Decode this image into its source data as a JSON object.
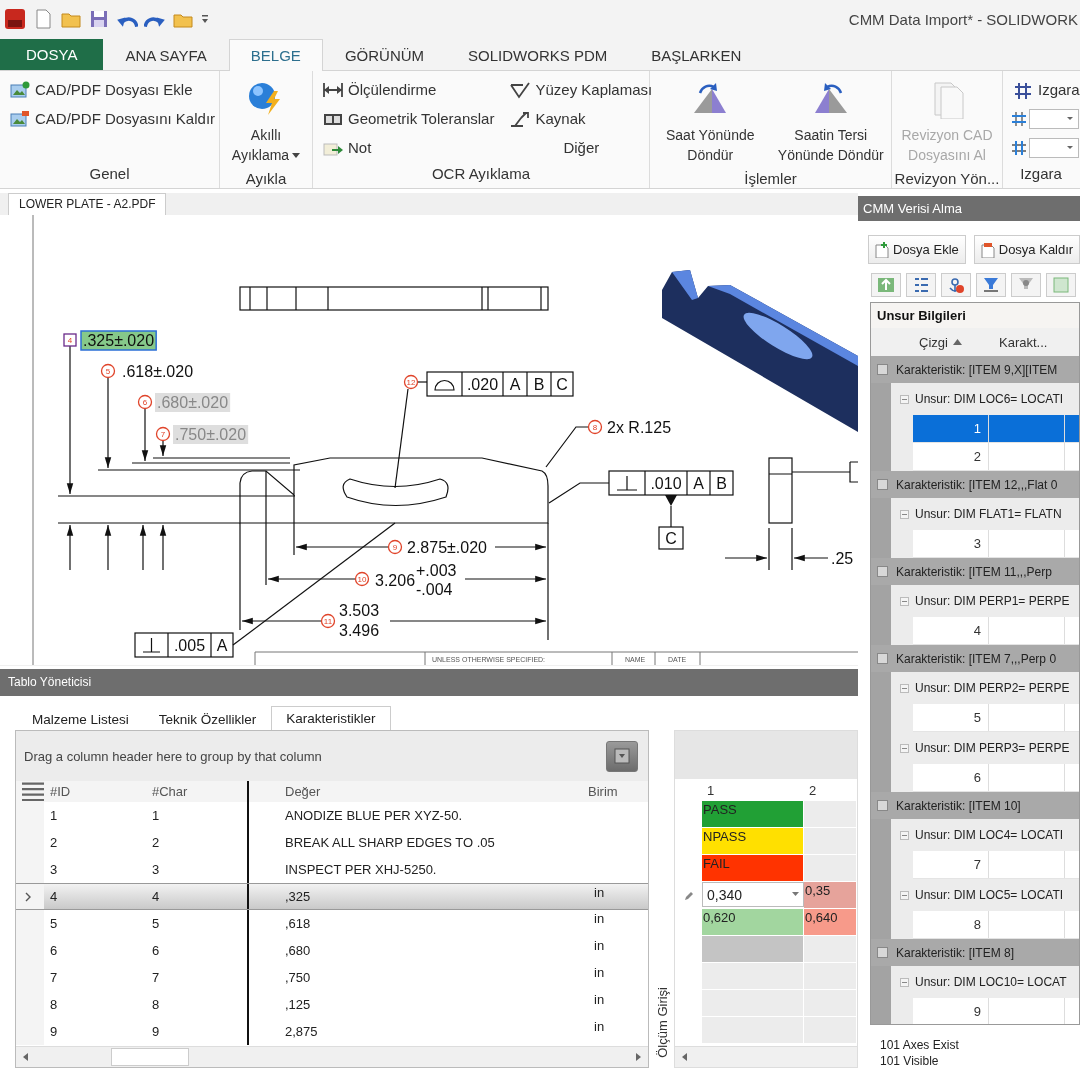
{
  "window": {
    "title": "CMM Data Import* - SOLIDWORK"
  },
  "ribbon": {
    "tabs": [
      {
        "label": "DOSYA",
        "kind": "file",
        "selected": false
      },
      {
        "label": "ANA SAYFA",
        "kind": "tab",
        "selected": false
      },
      {
        "label": "BELGE",
        "kind": "tab",
        "selected": true
      },
      {
        "label": "GÖRÜNÜM",
        "kind": "tab",
        "selected": false
      },
      {
        "label": "SOLIDWORKS PDM",
        "kind": "tab",
        "selected": false
      },
      {
        "label": "BAŞLARKEN",
        "kind": "tab",
        "selected": false
      }
    ],
    "groups": [
      {
        "label": "Genel",
        "columns": [
          [
            {
              "kind": "small",
              "label": "CAD/PDF Dosyası Ekle",
              "disabled": false
            },
            {
              "kind": "small",
              "label": "CAD/PDF Dosyasını Kaldır",
              "disabled": false
            }
          ]
        ]
      },
      {
        "label": "Ayıkla",
        "columns": [
          [
            {
              "kind": "large-menu",
              "label": "Akıllı Ayıklama",
              "disabled": false
            }
          ]
        ]
      },
      {
        "label": "OCR Ayıklama",
        "columns": [
          [
            {
              "kind": "small",
              "label": "Ölçülendirme",
              "disabled": false
            },
            {
              "kind": "small",
              "label": "Geometrik Toleranslar",
              "disabled": false
            },
            {
              "kind": "small",
              "label": "Not",
              "disabled": false
            }
          ],
          [
            {
              "kind": "small",
              "label": "Yüzey Kaplaması",
              "disabled": false
            },
            {
              "kind": "small",
              "label": "Kaynak",
              "disabled": false
            },
            {
              "kind": "label",
              "label": "Diğer"
            }
          ]
        ]
      },
      {
        "label": "İşlemler",
        "columns": [
          [
            {
              "kind": "large",
              "label": "Saat Yönünde Döndür",
              "disabled": false
            }
          ],
          [
            {
              "kind": "large",
              "label": "Saatin Tersi Yönünde Döndür",
              "disabled": false
            }
          ]
        ]
      },
      {
        "label": "Revizyon Yön...",
        "columns": [
          [
            {
              "kind": "large",
              "label": "Revizyon CAD Dosyasını Al",
              "disabled": true
            }
          ]
        ]
      },
      {
        "label": "Izgara",
        "columns": [
          [
            {
              "kind": "small",
              "label": "Izgara",
              "disabled": false
            },
            {
              "kind": "field"
            },
            {
              "kind": "field"
            }
          ]
        ]
      }
    ]
  },
  "document": {
    "tab": "LOWER PLATE - A2.PDF",
    "callouts": [
      {
        "number": "4",
        "kind": "square",
        "text": ".325±.020",
        "selected": true,
        "highlighted": true
      },
      {
        "number": "5",
        "kind": "circle",
        "text": ".618±.020",
        "selected": false,
        "highlighted": false
      },
      {
        "number": "6",
        "kind": "circle",
        "text": ".680±.020",
        "selected": false,
        "highlighted": true
      },
      {
        "number": "7",
        "kind": "circle",
        "text": ".750±.020",
        "selected": false,
        "highlighted": true
      },
      {
        "number": "8",
        "kind": "circle",
        "text": "2x R.125",
        "selected": false,
        "highlighted": false
      },
      {
        "number": "9",
        "kind": "circle",
        "text": "2.875±.020",
        "selected": false,
        "highlighted": false
      },
      {
        "number": "10",
        "kind": "circle",
        "text": "3.206",
        "upper": "+.003",
        "lower": "-.004",
        "selected": false,
        "highlighted": false
      },
      {
        "number": "11",
        "kind": "circle",
        "text": "3.503",
        "lower": "3.496",
        "selected": false,
        "highlighted": false
      }
    ],
    "frames": [
      {
        "number": "12",
        "kind": "profile",
        "cells": [
          ".020",
          "A",
          "B",
          "C"
        ]
      },
      {
        "kind": "perpendicular",
        "cells": [
          ".010",
          "A",
          "B"
        ],
        "datum": "C"
      },
      {
        "kind": "perpendicular",
        "cells": [
          ".005",
          "A"
        ]
      }
    ],
    "side_dimension": ".25",
    "title_block": [
      "UNLESS OTHERWISE SPECIFIED:",
      "NAME",
      "DATE"
    ]
  },
  "table_manager": {
    "title": "Tablo Yöneticisi",
    "tabs": [
      {
        "label": "Malzeme Listesi",
        "selected": false
      },
      {
        "label": "Teknik Özellikler",
        "selected": false
      },
      {
        "label": "Karakteristikler",
        "selected": true
      }
    ],
    "group_hint": "Drag a column header here to group by that column",
    "columns": [
      "#ID",
      "#Char",
      "Değer",
      "Birim"
    ],
    "rows": [
      {
        "id": "1",
        "char": "1",
        "value": "ANODIZE BLUE PER XYZ-50.",
        "selected": false
      },
      {
        "id": "2",
        "char": "2",
        "value": "BREAK ALL SHARP EDGES TO .05",
        "selected": false
      },
      {
        "id": "3",
        "char": "3",
        "value": "INSPECT PER XHJ-5250.",
        "selected": false
      },
      {
        "id": "4",
        "char": "4",
        "value": ",325",
        "unit": "in",
        "selected": true
      },
      {
        "id": "5",
        "char": "5",
        "value": ",618",
        "unit": "in",
        "selected": false
      },
      {
        "id": "6",
        "char": "6",
        "value": ",680",
        "unit": "in",
        "selected": false
      },
      {
        "id": "7",
        "char": "7",
        "value": ",750",
        "unit": "in",
        "selected": false
      },
      {
        "id": "8",
        "char": "8",
        "value": ",125",
        "unit": "in",
        "selected": false
      },
      {
        "id": "9",
        "char": "9",
        "value": "2,875",
        "unit": "in",
        "selected": false
      }
    ],
    "measurement": {
      "label": "Ölçüm Girişi",
      "columns": [
        "1",
        "2"
      ],
      "rows": [
        {
          "editing": false,
          "cells": [
            {
              "kind": "value",
              "text": "PASS",
              "color": "#21a035"
            },
            {
              "kind": "empty"
            }
          ]
        },
        {
          "editing": false,
          "cells": [
            {
              "kind": "value",
              "text": "NPASS",
              "color": "#ffe000"
            },
            {
              "kind": "empty"
            }
          ]
        },
        {
          "editing": false,
          "cells": [
            {
              "kind": "value",
              "text": "FAIL",
              "color": "#ff3300"
            },
            {
              "kind": "empty"
            }
          ]
        },
        {
          "editing": true,
          "cells": [
            {
              "kind": "input",
              "value": "0,340"
            },
            {
              "kind": "value",
              "text": "0,35",
              "color": "#e6a39b"
            }
          ]
        },
        {
          "editing": false,
          "cells": [
            {
              "kind": "value",
              "text": "0,620",
              "color": "#a2d69f"
            },
            {
              "kind": "value",
              "text": "0,640",
              "color": "#f79a8a"
            }
          ]
        },
        {
          "editing": false,
          "cells": [
            {
              "kind": "fill",
              "color": "#c4c4c4"
            },
            {
              "kind": "empty"
            }
          ]
        },
        {
          "editing": false,
          "cells": [
            {
              "kind": "empty"
            },
            {
              "kind": "empty"
            }
          ]
        },
        {
          "editing": false,
          "cells": [
            {
              "kind": "empty"
            },
            {
              "kind": "empty"
            }
          ]
        },
        {
          "editing": false,
          "cells": [
            {
              "kind": "empty"
            },
            {
              "kind": "empty"
            }
          ]
        }
      ]
    }
  },
  "cmm_panel": {
    "title": "CMM Verisi Alma",
    "buttons": [
      "Dosya Ekle",
      "Dosya Kaldır"
    ],
    "section": "Unsur Bilgileri",
    "columns": [
      {
        "label": "Çizgi",
        "sorted": true
      },
      {
        "label": "Karakt...",
        "sorted": false
      }
    ],
    "groups": [
      {
        "label": "Karakteristik: [ITEM 9,X][ITEM",
        "features": [
          {
            "label": "Unsur: DIM LOC6= LOCATI",
            "expanded": true,
            "rows": [
              {
                "line": "1",
                "selected": true
              },
              {
                "line": "2",
                "selected": false
              }
            ]
          }
        ]
      },
      {
        "label": "Karakteristik: [ITEM 12,,,Flat 0",
        "features": [
          {
            "label": "Unsur: DIM FLAT1= FLATN",
            "expanded": true,
            "rows": [
              {
                "line": "3",
                "selected": false
              }
            ]
          }
        ]
      },
      {
        "label": "Karakteristik: [ITEM 11,,,Perp",
        "features": [
          {
            "label": "Unsur: DIM PERP1= PERPE",
            "expanded": true,
            "rows": [
              {
                "line": "4",
                "selected": false
              }
            ]
          }
        ]
      },
      {
        "label": "Karakteristik: [ITEM 7,,,Perp 0",
        "features": [
          {
            "label": "Unsur: DIM PERP2= PERPE",
            "expanded": true,
            "rows": [
              {
                "line": "5",
                "selected": false
              }
            ]
          },
          {
            "label": "Unsur: DIM PERP3= PERPE",
            "expanded": true,
            "rows": [
              {
                "line": "6",
                "selected": false
              }
            ]
          }
        ]
      },
      {
        "label": "Karakteristik: [ITEM 10]",
        "features": [
          {
            "label": "Unsur: DIM LOC4= LOCATI",
            "expanded": true,
            "rows": [
              {
                "line": "7",
                "selected": false
              }
            ]
          },
          {
            "label": "Unsur: DIM LOC5= LOCATI",
            "expanded": true,
            "rows": [
              {
                "line": "8",
                "selected": false
              }
            ]
          }
        ]
      },
      {
        "label": "Karakteristik: [ITEM 8]",
        "features": [
          {
            "label": "Unsur: DIM LOC10= LOCAT",
            "expanded": true,
            "rows": [
              {
                "line": "9",
                "selected": false
              }
            ]
          }
        ]
      }
    ],
    "footer": [
      "101 Axes Exist",
      "101 Visible"
    ]
  }
}
